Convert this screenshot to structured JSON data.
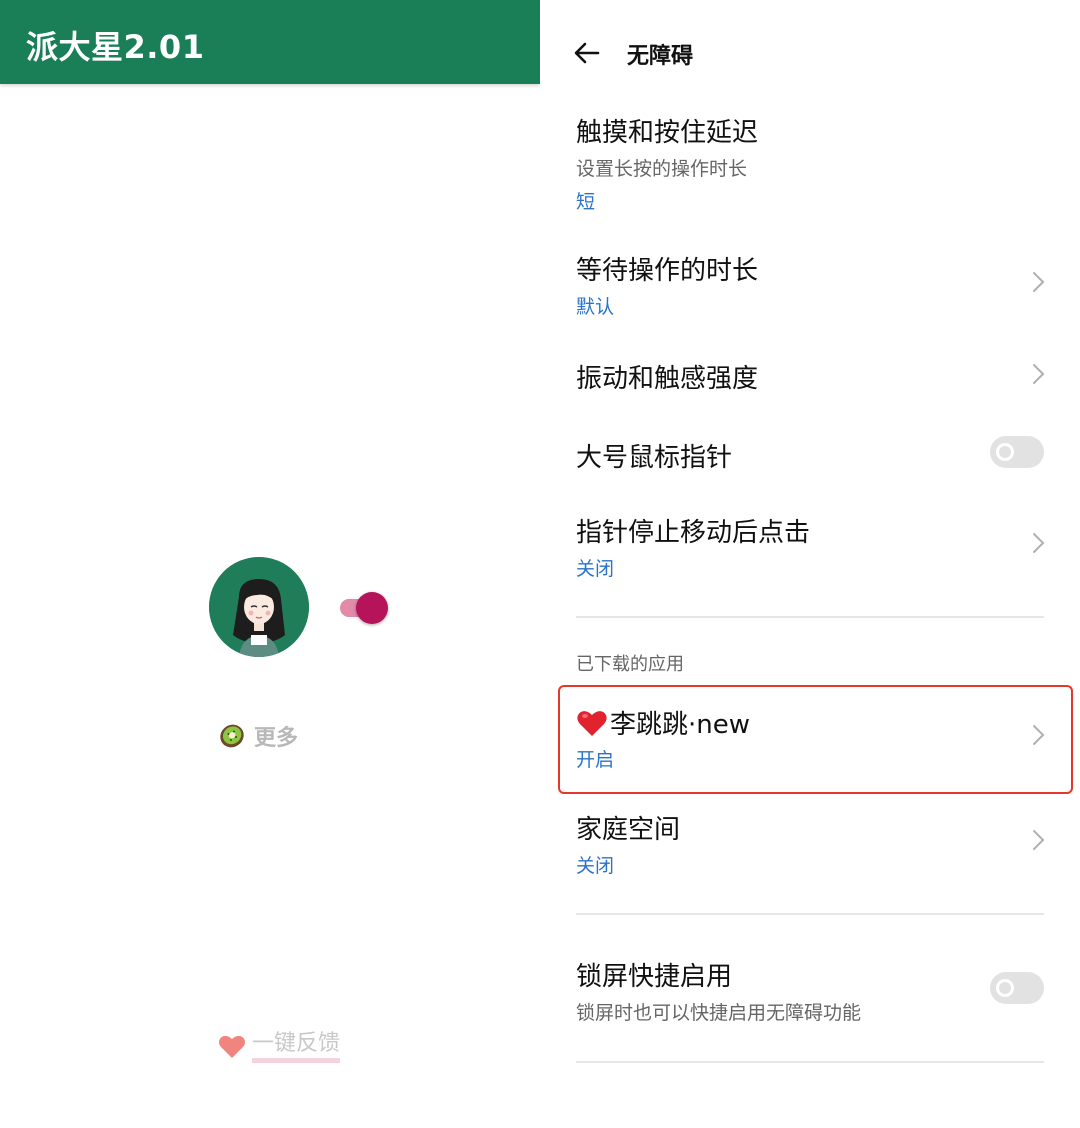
{
  "left": {
    "app_title": "派大星2.01",
    "more_label": "更多",
    "feedback_label": "一键反馈",
    "icons": {
      "avatar": "avatar-girl",
      "kiwi": "kiwi-icon",
      "heart": "heart-icon"
    },
    "colors": {
      "appbar": "#1a7f56",
      "switch_thumb": "#b5145a",
      "switch_track": "#e28aa8"
    },
    "switch_on": true
  },
  "right": {
    "title": "无障碍",
    "items": [
      {
        "title": "触摸和按住延迟",
        "subtitle": "设置长按的操作时长",
        "value": "短"
      },
      {
        "title": "等待操作的时长",
        "value": "默认"
      },
      {
        "title": "振动和触感强度"
      },
      {
        "title": "大号鼠标指针",
        "toggle_on": false
      },
      {
        "title": "指针停止移动后点击",
        "value": "关闭"
      }
    ],
    "section_header": "已下载的应用",
    "apps": [
      {
        "title": "李跳跳·new",
        "value": "开启",
        "highlighted": true
      },
      {
        "title": "家庭空间",
        "value": "关闭"
      }
    ],
    "lock_screen": {
      "title": "锁屏快捷启用",
      "subtitle": "锁屏时也可以快捷启用无障碍功能",
      "toggle_on": false
    },
    "colors": {
      "value_text": "#2a73c8",
      "highlight_border": "#e5382d"
    }
  }
}
